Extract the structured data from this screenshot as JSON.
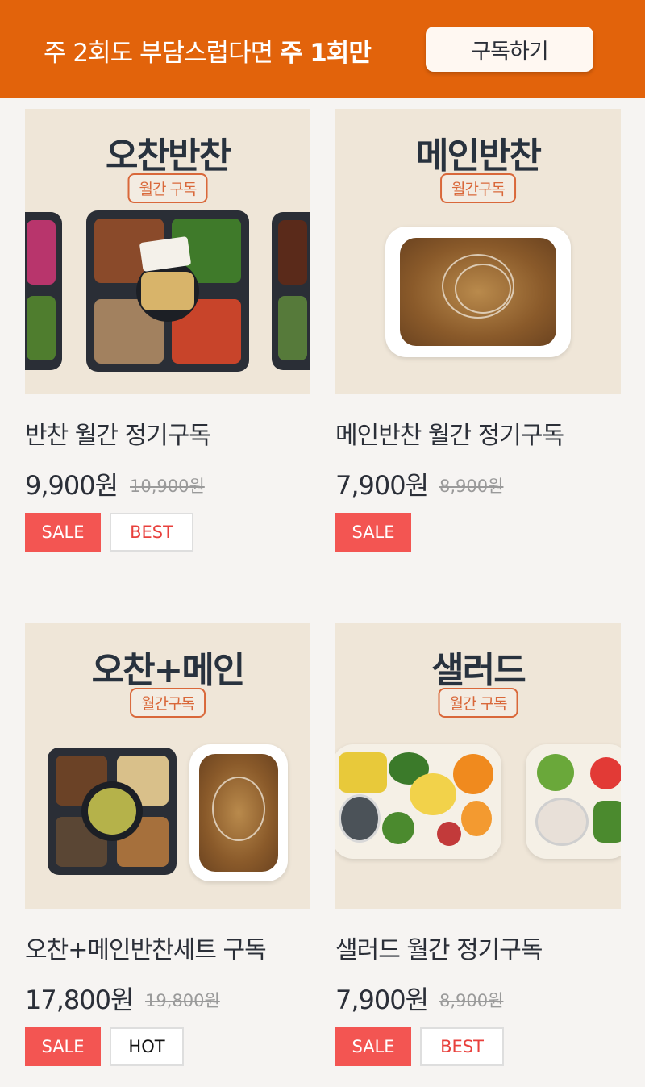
{
  "banner": {
    "text_prefix": "주 2회도 부담스럽다면 ",
    "text_bold": "주 1회만",
    "button_label": "구독하기"
  },
  "products": [
    {
      "image_title": "오찬반찬",
      "image_tag": "월간 구독",
      "name": "반찬 월간 정기구독",
      "price": "9,900원",
      "original_price": "10,900원",
      "badges": [
        "SALE",
        "BEST"
      ]
    },
    {
      "image_title": "메인반찬",
      "image_tag": "월간구독",
      "name": "메인반찬 월간 정기구독",
      "price": "7,900원",
      "original_price": "8,900원",
      "badges": [
        "SALE"
      ]
    },
    {
      "image_title": "오찬+메인",
      "image_tag": "월간구독",
      "name": "오찬+메인반찬세트 구독",
      "price": "17,800원",
      "original_price": "19,800원",
      "badges": [
        "SALE",
        "HOT"
      ]
    },
    {
      "image_title": "샐러드",
      "image_tag": "월간 구독",
      "name": "샐러드 월간 정기구독",
      "price": "7,900원",
      "original_price": "8,900원",
      "badges": [
        "SALE",
        "BEST"
      ]
    }
  ],
  "colors": {
    "banner": "#e2630b",
    "sale": "#f35552",
    "best": "#e8403c",
    "image_bg": "#efe6d8"
  }
}
